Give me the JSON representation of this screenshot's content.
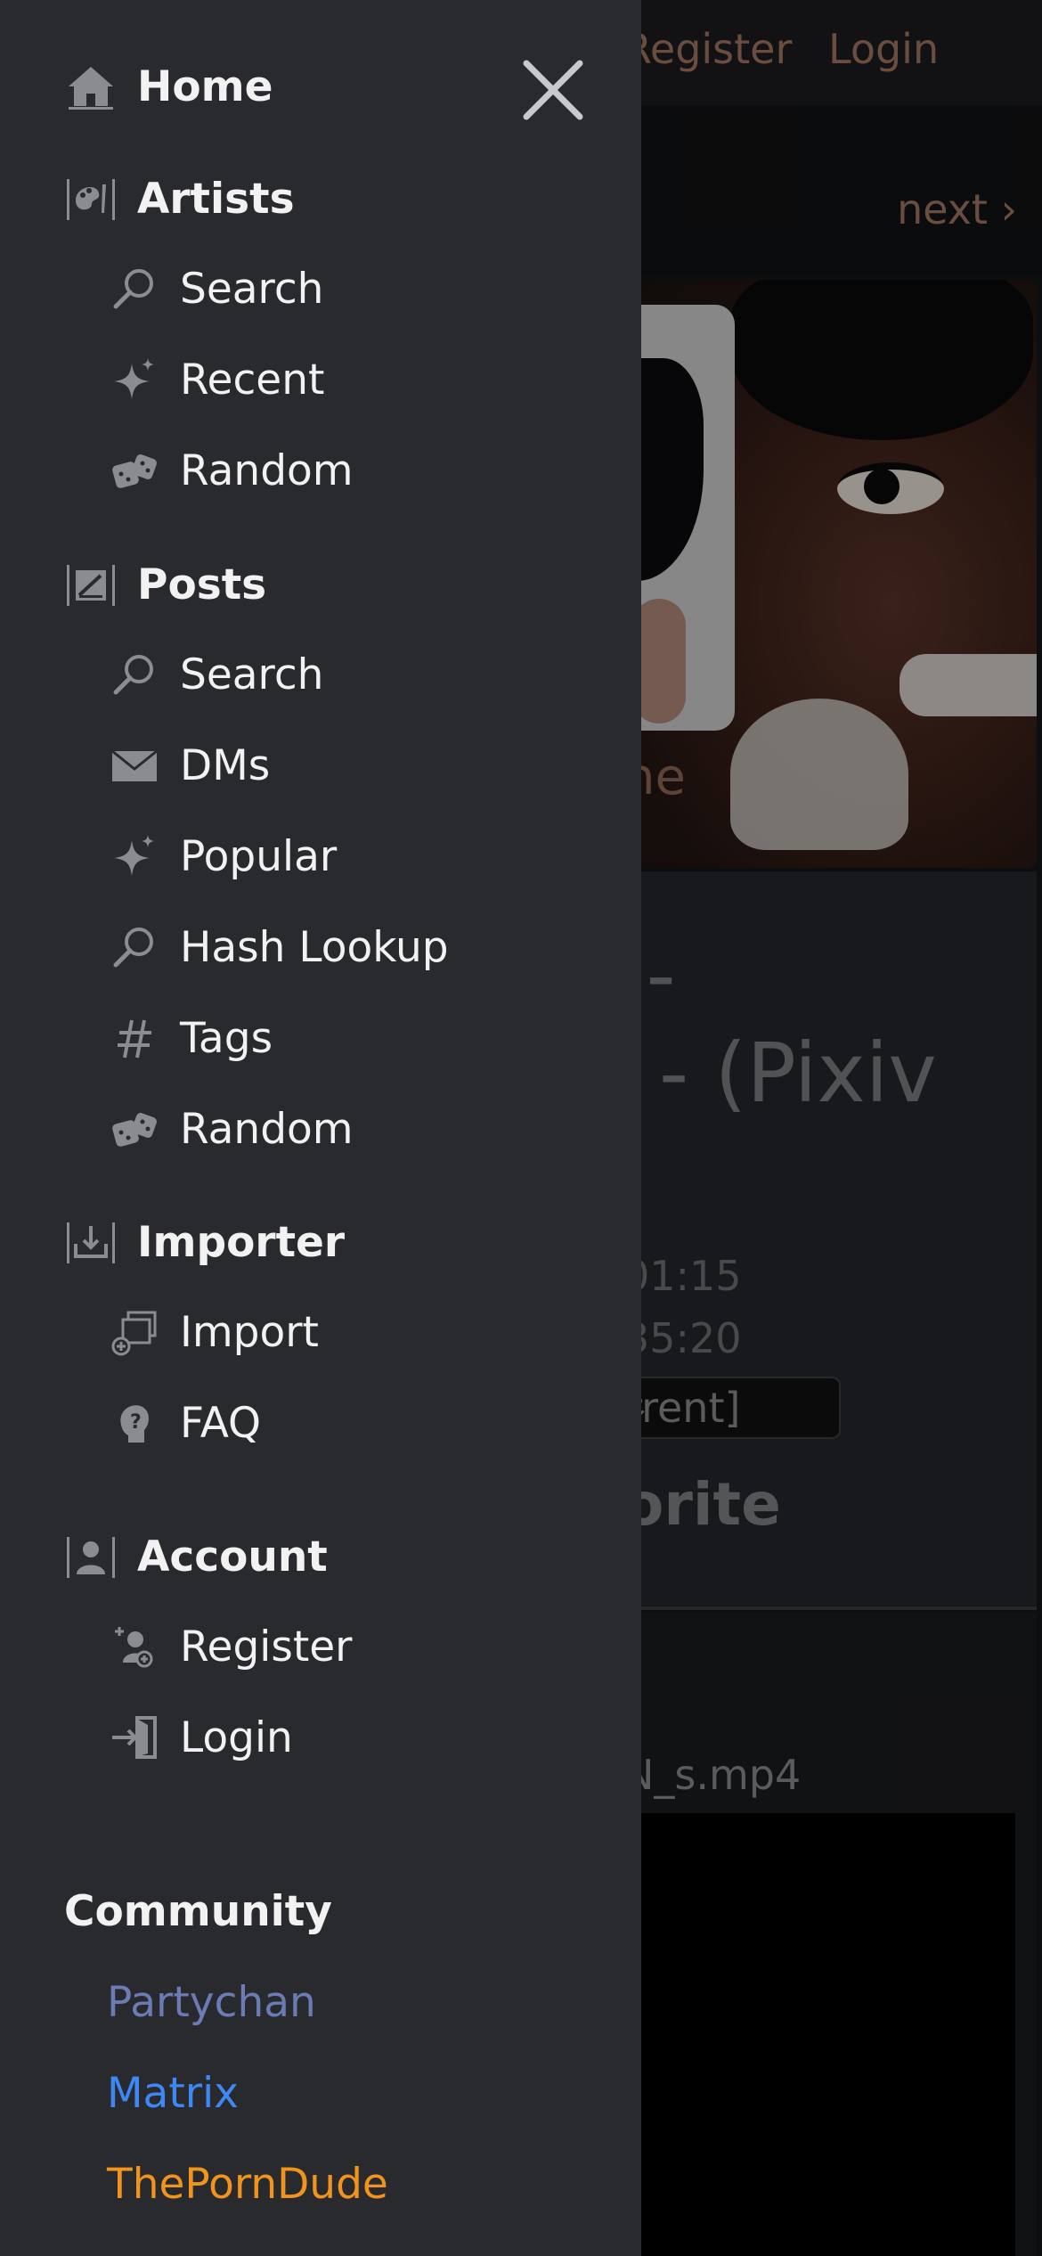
{
  "background": {
    "header": {
      "register": "Register",
      "login": "Login"
    },
    "pager": {
      "next": "next ›"
    },
    "artist_name_fragment": "ne",
    "title_fragments": [
      "j-",
      "- (Pixiv"
    ],
    "dates": [
      "01:15",
      "35:20"
    ],
    "revision_select": "rrent]",
    "favorite_fragment": "orite",
    "file_fragment": "N_s.mp4"
  },
  "sidebar": {
    "home": {
      "label": "Home",
      "icon": "home-icon"
    },
    "artists": {
      "label": "Artists",
      "icon": "palette-icon",
      "items": [
        {
          "label": "Search",
          "icon": "search-icon"
        },
        {
          "label": "Recent",
          "icon": "sparkle-icon"
        },
        {
          "label": "Random",
          "icon": "dice-icon"
        }
      ]
    },
    "posts": {
      "label": "Posts",
      "icon": "posts-icon",
      "items": [
        {
          "label": "Search",
          "icon": "search-icon"
        },
        {
          "label": "DMs",
          "icon": "envelope-icon"
        },
        {
          "label": "Popular",
          "icon": "sparkle-icon"
        },
        {
          "label": "Hash Lookup",
          "icon": "search-icon"
        },
        {
          "label": "Tags",
          "icon": "hash-icon"
        },
        {
          "label": "Random",
          "icon": "dice-icon"
        }
      ]
    },
    "importer": {
      "label": "Importer",
      "icon": "importer-icon",
      "items": [
        {
          "label": "Import",
          "icon": "import-icon"
        },
        {
          "label": "FAQ",
          "icon": "faq-icon"
        }
      ]
    },
    "account": {
      "label": "Account",
      "icon": "account-icon",
      "items": [
        {
          "label": "Register",
          "icon": "register-icon"
        },
        {
          "label": "Login",
          "icon": "login-icon"
        }
      ]
    },
    "community": {
      "label": "Community",
      "links": [
        {
          "label": "Partychan",
          "color": "#6b7bb3"
        },
        {
          "label": "Matrix",
          "color": "#3f87f5"
        },
        {
          "label": "ThePornDude",
          "color": "#f0941e"
        }
      ]
    }
  },
  "colors": {
    "sidebar_bg": "#282a2e",
    "icon_gray": "#8a8c90",
    "accent_link": "#a37762"
  }
}
